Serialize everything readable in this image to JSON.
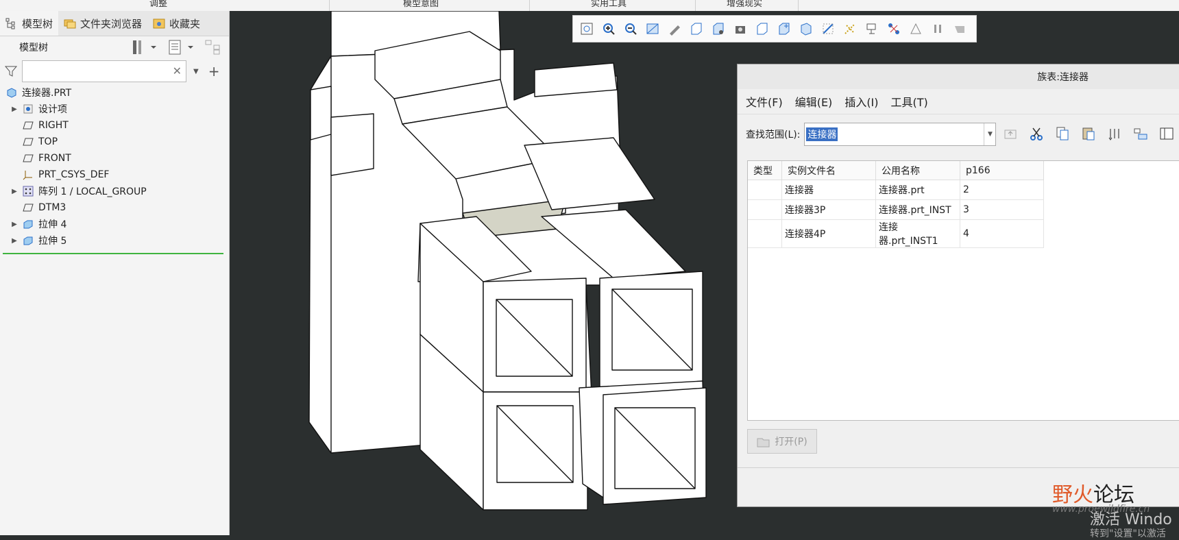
{
  "ribbon": {
    "groups": [
      "调整",
      "模型意图",
      "实用工具",
      "增强现实"
    ]
  },
  "left_panel": {
    "tabs": [
      {
        "label": "模型树",
        "icon": "tree-icon"
      },
      {
        "label": "文件夹浏览器",
        "icon": "folder-browser-icon"
      },
      {
        "label": "收藏夹",
        "icon": "favorites-icon"
      }
    ],
    "tree_title": "模型树",
    "filter_placeholder": "",
    "tree": [
      {
        "label": "连接器.PRT",
        "icon": "part-icon",
        "expandable": false,
        "indent": 0
      },
      {
        "label": "设计项",
        "icon": "design-items-icon",
        "expandable": true,
        "indent": 1
      },
      {
        "label": "RIGHT",
        "icon": "datum-plane-icon",
        "expandable": false,
        "indent": 1
      },
      {
        "label": "TOP",
        "icon": "datum-plane-icon",
        "expandable": false,
        "indent": 1
      },
      {
        "label": "FRONT",
        "icon": "datum-plane-icon",
        "expandable": false,
        "indent": 1
      },
      {
        "label": "PRT_CSYS_DEF",
        "icon": "csys-icon",
        "expandable": false,
        "indent": 1
      },
      {
        "label": "阵列 1 / LOCAL_GROUP",
        "icon": "pattern-icon",
        "expandable": true,
        "indent": 1
      },
      {
        "label": "DTM3",
        "icon": "datum-plane-icon",
        "expandable": false,
        "indent": 1
      },
      {
        "label": "拉伸 4",
        "icon": "extrude-icon",
        "expandable": true,
        "indent": 1
      },
      {
        "label": "拉伸 5",
        "icon": "extrude-icon",
        "expandable": true,
        "indent": 1
      }
    ]
  },
  "dialog": {
    "title": "族表:连接器",
    "menu": [
      "文件(F)",
      "编辑(E)",
      "插入(I)",
      "工具(T)"
    ],
    "search_label": "查找范围(L):",
    "search_value": "连接器",
    "columns": [
      "类型",
      "实例文件名",
      "公用名称",
      "p166"
    ],
    "rows": [
      [
        "",
        "连接器",
        "连接器.prt",
        "2"
      ],
      [
        "",
        "连接器3P",
        "连接器.prt_INST",
        "3"
      ],
      [
        "",
        "连接器4P",
        "连接器.prt_INST1",
        "4"
      ]
    ],
    "open_button": "打开(P)"
  },
  "watermark": {
    "brand_a": "野火",
    "brand_b": "论坛",
    "url": "www.proewildfire.cn",
    "activate_line1": "激活 Windo",
    "activate_line2": "转到\"设置\"以激活"
  },
  "colors": {
    "viewport_bg": "#2b2f2f",
    "tree_green": "#3fb43f",
    "selection_blue": "#3a70c4"
  }
}
